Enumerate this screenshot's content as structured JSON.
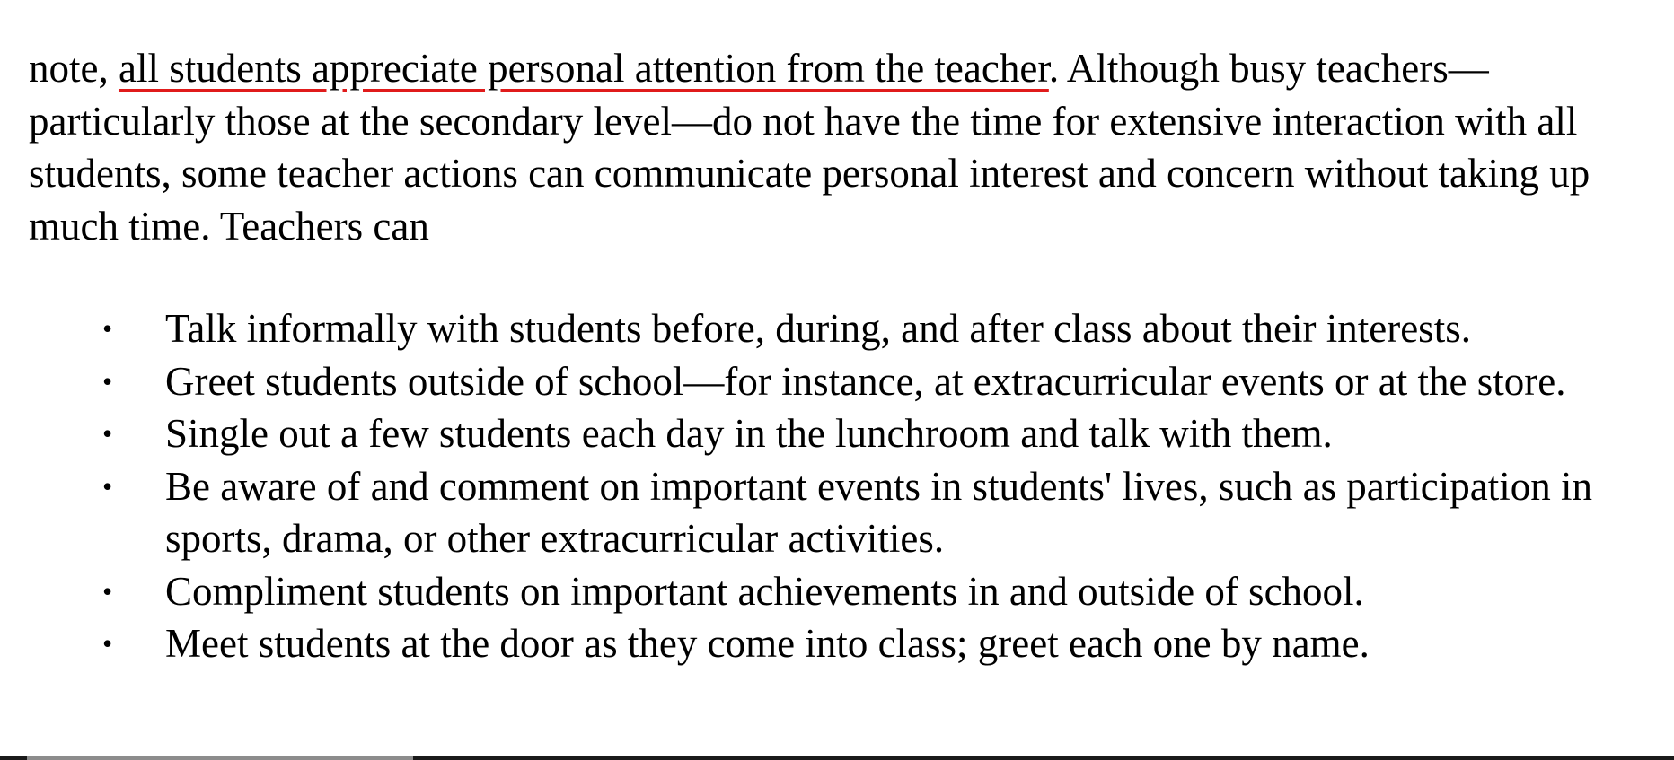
{
  "paragraph": {
    "before_highlight": "note, ",
    "highlight": "all students appreciate personal attention from the teacher",
    "after_highlight": ". Although busy teachers—particularly those at the secondary level—do not have the time for extensive interaction with all students, some teacher actions can communicate personal interest and concern without taking up much time. Teachers can"
  },
  "bullet_glyph": "•",
  "bullets": [
    "Talk informally with students before, during, and after class about their interests.",
    "Greet students outside of school—for instance, at extracurricular events or at the store.",
    "Single out a few students each day in the lunchroom and talk with them.",
    "Be aware of and comment on important events in students' lives, such as participation in sports, drama, or other extracurricular activities.",
    "Compliment students on important achievements in and outside of school.",
    "Meet students at the door as they come into class; greet each one by name."
  ],
  "colors": {
    "text": "#000000",
    "highlight_underline": "#e01b1b",
    "background": "#ffffff"
  }
}
